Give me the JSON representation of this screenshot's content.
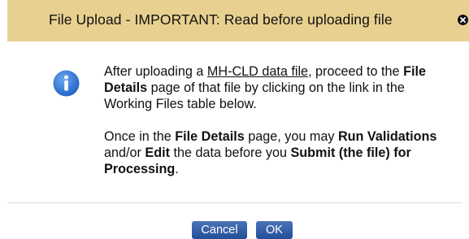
{
  "dialog": {
    "title": "File Upload - IMPORTANT: Read before uploading file",
    "close_icon": "close-icon",
    "info_icon": "info-icon",
    "message": {
      "p1_part1": "After uploading a ",
      "p1_link": "MH-CLD data file",
      "p1_part2": ", proceed to the ",
      "p1_bold1": "File Details",
      "p1_part3": " page of that file by clicking on the link in the Working Files table below.",
      "p2_part1": "Once in the ",
      "p2_bold1": "File Details",
      "p2_part2": " page, you may ",
      "p2_bold2": "Run Validations",
      "p2_part3": " and/or ",
      "p2_bold3": "Edit",
      "p2_part4": " the data before you ",
      "p2_bold4": "Submit (the file) for Processing",
      "p2_part5": "."
    },
    "buttons": {
      "cancel": "Cancel",
      "ok": "OK"
    }
  },
  "colors": {
    "header_bg": "#e8d190",
    "button_bg": "#2f5ca6",
    "info_icon_bg": "#2a6fd0"
  }
}
